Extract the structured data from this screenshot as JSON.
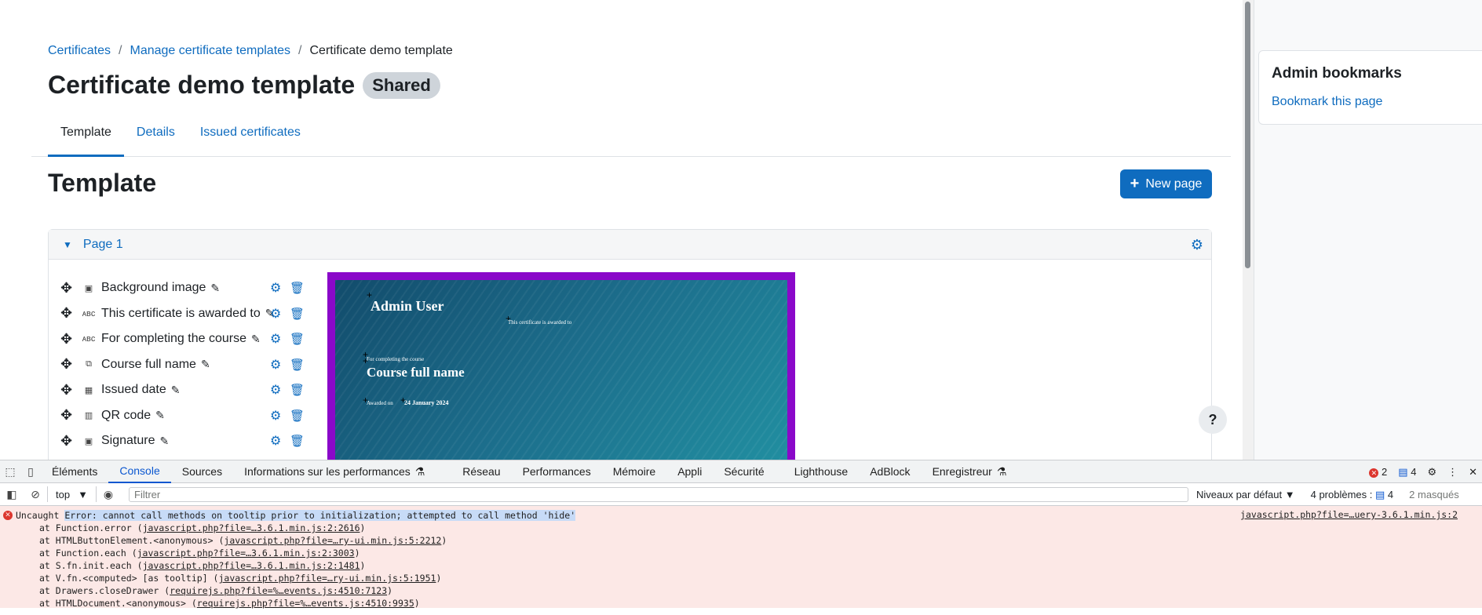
{
  "breadcrumb": {
    "items": [
      "Certificates",
      "Manage certificate templates"
    ],
    "current": "Certificate demo template",
    "separator": "/"
  },
  "header": {
    "title": "Certificate demo template",
    "badge": "Shared"
  },
  "tabs": [
    {
      "label": "Template",
      "active": true
    },
    {
      "label": "Details",
      "active": false
    },
    {
      "label": "Issued certificates",
      "active": false
    }
  ],
  "section": {
    "title": "Template",
    "new_page_label": "New page"
  },
  "page_card": {
    "label": "Page 1",
    "elements": [
      {
        "label": "Background image",
        "icon": "image-icon"
      },
      {
        "label": "This certificate is awarded to",
        "icon": "text-icon"
      },
      {
        "label": "For completing the course",
        "icon": "text-icon"
      },
      {
        "label": "Course full name",
        "icon": "copy-icon"
      },
      {
        "label": "Issued date",
        "icon": "calendar-icon"
      },
      {
        "label": "QR code",
        "icon": "barcode-icon"
      },
      {
        "label": "Signature",
        "icon": "image-icon"
      }
    ]
  },
  "certificate_preview": {
    "name": "Admin User",
    "awarded_to": "This certificate is awarded to",
    "completing": "For completing the course",
    "course": "Course full name",
    "awarded_on": "Awarded on",
    "date": "24 January 2024",
    "border_color": "#8a08c9"
  },
  "drawer": {
    "block_title": "Admin bookmarks",
    "bookmark_link": "Bookmark this page"
  },
  "devtools": {
    "tabs": [
      "Éléments",
      "Console",
      "Sources",
      "Informations sur les performances",
      "Réseau",
      "Performances",
      "Mémoire",
      "Appli",
      "Sécurité",
      "Lighthouse",
      "AdBlock",
      "Enregistreur"
    ],
    "active_tab": "Console",
    "error_count": "2",
    "message_count": "4",
    "context": "top",
    "filter_placeholder": "Filtrer",
    "levels": "Niveaux par défaut",
    "problems": "4 problèmes :",
    "problems_count": "4",
    "hidden": "2 masqués",
    "error": {
      "prefix": "Uncaught ",
      "message": "Error: cannot call methods on tooltip prior to initialization; attempted to call method 'hide'",
      "source": "javascript.php?file=…uery-3.6.1.min.js:2",
      "stack": [
        {
          "text": "at Function.error (",
          "link": "javascript.php?file=…3.6.1.min.js:2:2616",
          "end": ")"
        },
        {
          "text": "at HTMLButtonElement.<anonymous> (",
          "link": "javascript.php?file=…ry-ui.min.js:5:2212",
          "end": ")"
        },
        {
          "text": "at Function.each (",
          "link": "javascript.php?file=…3.6.1.min.js:2:3003",
          "end": ")"
        },
        {
          "text": "at S.fn.init.each (",
          "link": "javascript.php?file=…3.6.1.min.js:2:1481",
          "end": ")"
        },
        {
          "text": "at V.fn.<computed> [as tooltip] (",
          "link": "javascript.php?file=…ry-ui.min.js:5:1951",
          "end": ")"
        },
        {
          "text": "at Drawers.closeDrawer (",
          "link": "requirejs.php?file=%…events.js:4510:7123",
          "end": ")"
        },
        {
          "text": "at HTMLDocument.<anonymous> (",
          "link": "requirejs.php?file=%…events.js:4510:9935",
          "end": ")"
        }
      ]
    }
  },
  "colors": {
    "link": "#0f6cbf",
    "primary_button": "#0f6cbf",
    "badge_bg": "#ced4da",
    "console_error_bg": "#fce8e6"
  }
}
